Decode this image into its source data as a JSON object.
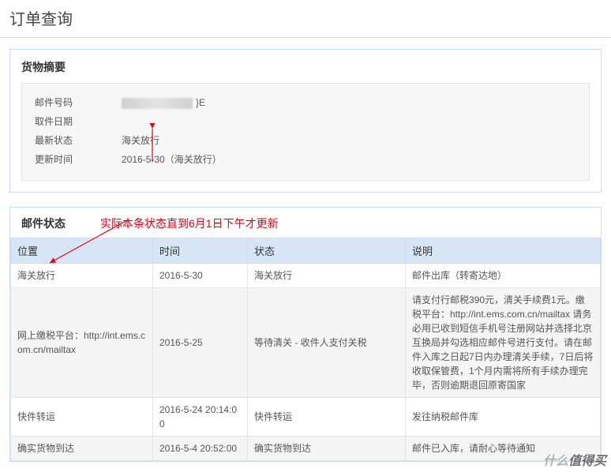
{
  "page_title": "订单查询",
  "summary": {
    "panel_title": "货物摘要",
    "rows": [
      {
        "label": "邮件号码",
        "value_suffix": "}E",
        "blurred": true
      },
      {
        "label": "取件日期",
        "value": ""
      },
      {
        "label": "最新状态",
        "value": "海关放行"
      },
      {
        "label": "更新时间",
        "value": "2016-5-30（海关放行）"
      }
    ]
  },
  "annotation": "实际本条状态直到6月1日下午才更新",
  "status": {
    "panel_title": "邮件状态",
    "columns": [
      "位置",
      "时间",
      "状态",
      "说明"
    ],
    "rows": [
      {
        "location": "海关放行",
        "time": "2016-5-30",
        "state": "海关放行",
        "desc": "邮件出库（转寄达地）"
      },
      {
        "location": "网上缴税平台：http://int.ems.com.cn/mailtax",
        "time": "2016-5-25",
        "state": "等待清关 - 收件人支付关税",
        "desc": "请支付行邮税390元，清关手续费1元。缴税平台：http://int.ems.com.cn/mailtax 请务必用已收到短信手机号注册网站并选择北京互换局并勾选相应邮件号进行支付。请在邮件入库之日起7日内办理清关手续，7日后将收取保管费，1个月内需将所有手续办理完毕，否则逾期退回原寄国家"
      },
      {
        "location": "快件转运",
        "time": "2016-5-24 20:14:00",
        "state": "快件转运",
        "desc": "发往纳税邮件库"
      },
      {
        "location": "确实货物到达",
        "time": "2016-5-4 20:52:00",
        "state": "确实货物到达",
        "desc": "邮件已入库，请耐心等待通知"
      }
    ]
  },
  "watermark": "值得买"
}
